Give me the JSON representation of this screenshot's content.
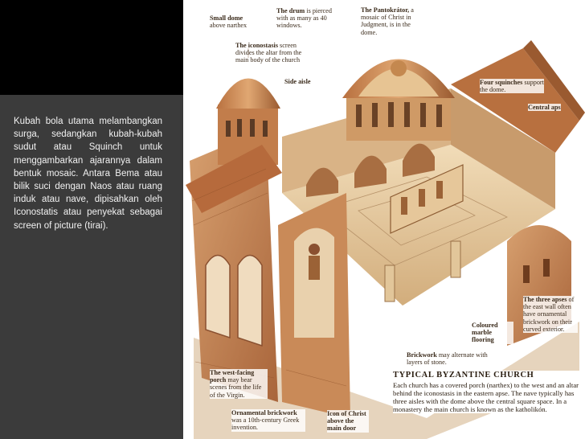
{
  "slide": {
    "body_text": "Kubah bola utama melambangkan surga, sedangkan kubah-kubah sudut atau Squinch untuk menggambarkan ajarannya dalam bentuk mosaic. Antara Bema atau bilik suci dengan Naos atau ruang induk atau nave, dipisahkan oleh Iconostatis atau penyekat sebagai screen of picture (tirai)."
  },
  "annotations": {
    "small_dome": {
      "bold": "Small dome",
      "text": " above narthex"
    },
    "drum": {
      "bold": "The drum",
      "text": " is pierced with as many as 40 windows."
    },
    "pantokrator": {
      "bold": "The Pantokrátor,",
      "text": " a mosaic of Christ in Judgment, is in the dome."
    },
    "iconostasis": {
      "bold": "The iconostasis",
      "text": " screen divides the altar from the main body of the church"
    },
    "side_aisle": {
      "bold": "Side aisle",
      "text": ""
    },
    "squinches": {
      "bold": "Four squinches",
      "text": " support the dome."
    },
    "central_apse": {
      "bold": "Central aps",
      "text": ""
    },
    "three_apses": {
      "bold": "The three apses",
      "text": " of the east wall often have ornamental brickwork on their curved exterior."
    },
    "marble": {
      "bold": "Coloured marble flooring",
      "text": ""
    },
    "brickwork": {
      "bold": "Brickwork",
      "text": " may alternate with layers of stone."
    },
    "porch": {
      "bold": "The west-facing porch",
      "text": " may bear scenes from the life of the Virgin."
    },
    "ornamental": {
      "bold": "Ornamental brickwork",
      "text": " was a 10th-century Greek invention."
    },
    "icon_christ": {
      "bold": "Icon of Christ above the main door",
      "text": ""
    }
  },
  "caption": {
    "title": "TYPICAL BYZANTINE CHURCH",
    "text": "Each church has a covered porch (narthex) to the west and an altar behind the iconostasis in the eastern apse. The nave typically has three aisles with the dome above the central square space. In a monastery the main church is known as the katholikón."
  },
  "colors": {
    "panel_bg": "#3b3b3b",
    "top_band": "#000000",
    "brick": "#c58a5c",
    "stone": "#e8cfa8"
  }
}
